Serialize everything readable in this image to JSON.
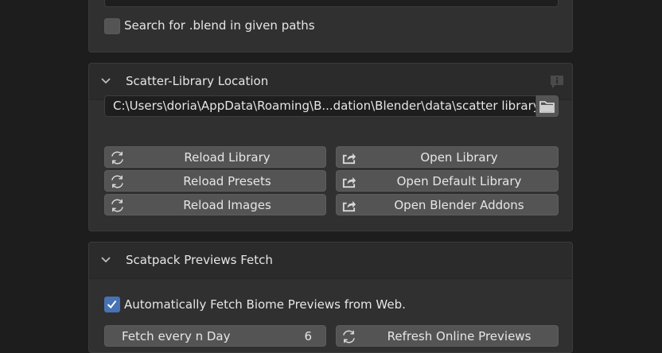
{
  "top_panel": {
    "checkbox_label": "Search for .blend in given paths",
    "checked": false
  },
  "location_panel": {
    "title": "Scatter-Library Location",
    "path_value": "C:\\Users\\doria\\AppData\\Roaming\\B...dation\\Blender\\data\\scatter library",
    "buttons": {
      "reload_library": "Reload Library",
      "reload_presets": "Reload Presets",
      "reload_images": "Reload Images",
      "open_library": "Open Library",
      "open_default_library": "Open Default Library",
      "open_blender_addons": "Open Blender Addons"
    }
  },
  "previews_panel": {
    "title": "Scatpack Previews Fetch",
    "auto_fetch_label": "Automatically Fetch Biome Previews from Web.",
    "auto_fetch_checked": true,
    "fetch_field_label": "Fetch every n Day",
    "fetch_field_value": "6",
    "refresh_button": "Refresh Online Previews"
  },
  "colors": {
    "panel_bg": "#303030",
    "header_bg": "#2b2b2b",
    "button_bg": "#545454",
    "checkbox_accent": "#4772b3"
  },
  "icons": [
    "chevron-down-icon",
    "info-icon",
    "folder-icon",
    "refresh-icon",
    "open-external-icon",
    "check-icon"
  ]
}
